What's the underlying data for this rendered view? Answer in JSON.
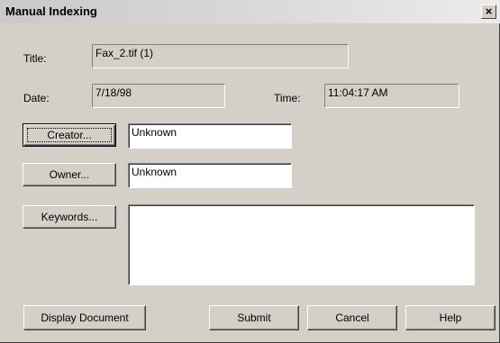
{
  "window": {
    "title": "Manual Indexing",
    "close_glyph": "×"
  },
  "fields": {
    "title_label": "Title:",
    "title_value": "Fax_2.tif (1)",
    "date_label": "Date:",
    "date_value": "7/18/98",
    "time_label": "Time:",
    "time_value": "11:04:17 AM"
  },
  "creator": {
    "button_label": "Creator...",
    "value": "Unknown"
  },
  "owner": {
    "button_label": "Owner...",
    "value": "Unknown"
  },
  "keywords": {
    "button_label": "Keywords...",
    "value": ""
  },
  "buttons": {
    "display_document": "Display Document",
    "submit": "Submit",
    "cancel": "Cancel",
    "help": "Help"
  }
}
